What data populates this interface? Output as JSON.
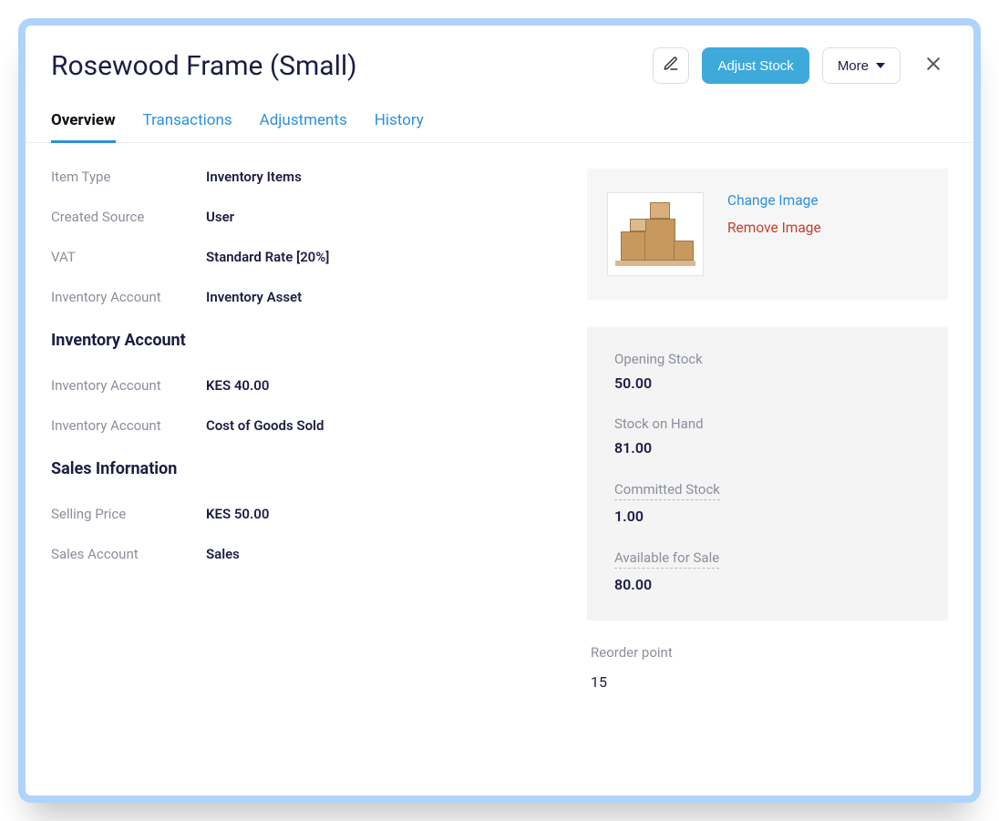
{
  "header": {
    "title": "Rosewood Frame (Small)",
    "adjust_stock": "Adjust Stock",
    "more": "More"
  },
  "tabs": {
    "overview": "Overview",
    "transactions": "Transactions",
    "adjustments": "Adjustments",
    "history": "History"
  },
  "details": {
    "item_type_label": "Item Type",
    "item_type_value": "Inventory Items",
    "created_source_label": "Created Source",
    "created_source_value": "User",
    "vat_label": "VAT",
    "vat_value": "Standard Rate [20%]",
    "inventory_account_label": "Inventory Account",
    "inventory_account_value": "Inventory Asset"
  },
  "inventory_section": {
    "title": "Inventory Account",
    "row1_label": "Inventory Account",
    "row1_value": "KES 40.00",
    "row2_label": "Inventory Account",
    "row2_value": "Cost of Goods Sold"
  },
  "sales_section": {
    "title": "Sales Infornation",
    "selling_price_label": "Selling Price",
    "selling_price_value": "KES 50.00",
    "sales_account_label": "Sales Account",
    "sales_account_value": "Sales"
  },
  "image_card": {
    "change": "Change Image",
    "remove": "Remove Image"
  },
  "stock": {
    "opening_label": "Opening Stock",
    "opening_value": "50.00",
    "on_hand_label": "Stock on Hand",
    "on_hand_value": "81.00",
    "committed_label": "Committed Stock",
    "committed_value": "1.00",
    "available_label": "Available for Sale",
    "available_value": "80.00"
  },
  "reorder": {
    "label": "Reorder point",
    "value": "15"
  }
}
